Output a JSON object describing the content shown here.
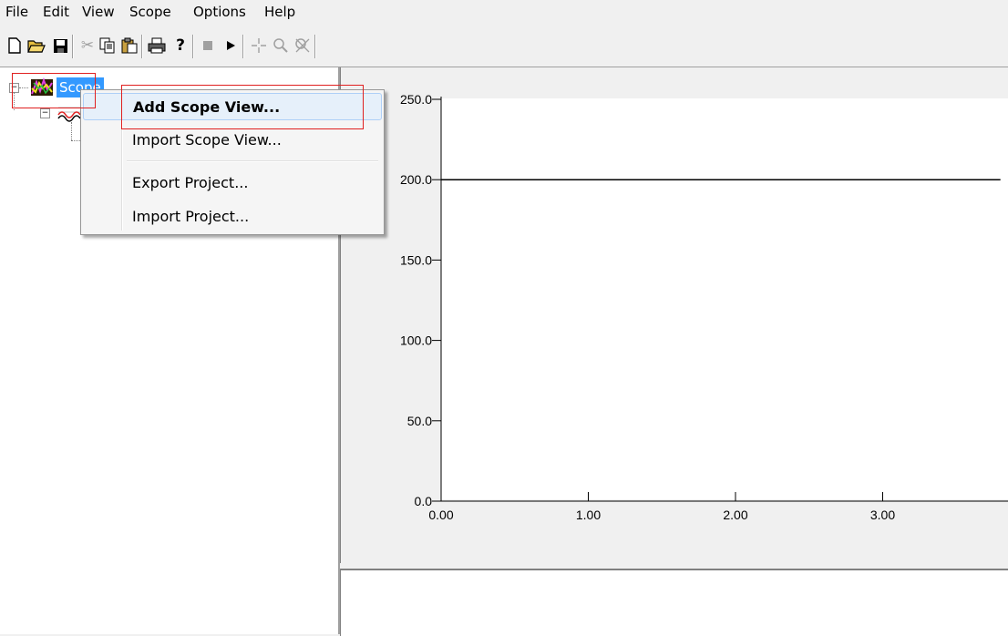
{
  "menu": [
    "File",
    "Edit",
    "View",
    "Scope",
    "Options",
    "Help"
  ],
  "toolbar": {
    "icons": [
      "new-icon",
      "open-icon",
      "save-icon",
      "cut-icon",
      "copy-icon",
      "paste-icon",
      "print-icon",
      "help-icon",
      "stop-icon",
      "play-icon",
      "crosshair-icon",
      "zoom-icon",
      "zoom-reset-icon"
    ]
  },
  "tree": {
    "root_label": "Scope"
  },
  "context_menu": {
    "items": [
      "Add Scope View...",
      "Import Scope  View...",
      "Export Project...",
      "Import Project..."
    ]
  },
  "chart_data": {
    "type": "line",
    "title": "",
    "xlabel": "",
    "ylabel": "",
    "x_ticks": [
      "0.00",
      "1.00",
      "2.00",
      "3.00"
    ],
    "y_ticks": [
      "250.0",
      "200.0",
      "150.0",
      "100.0",
      "50.0",
      "0.0"
    ],
    "ylim": [
      0,
      250
    ],
    "xlim": [
      0,
      3.8
    ],
    "series": [
      {
        "x": [
          0,
          3.8
        ],
        "values": [
          200,
          200
        ]
      }
    ],
    "grid": false
  },
  "colors": {
    "selection": "#3399ff",
    "highlight_box": "#e02020",
    "menu_hover": "#e6f0fa"
  }
}
